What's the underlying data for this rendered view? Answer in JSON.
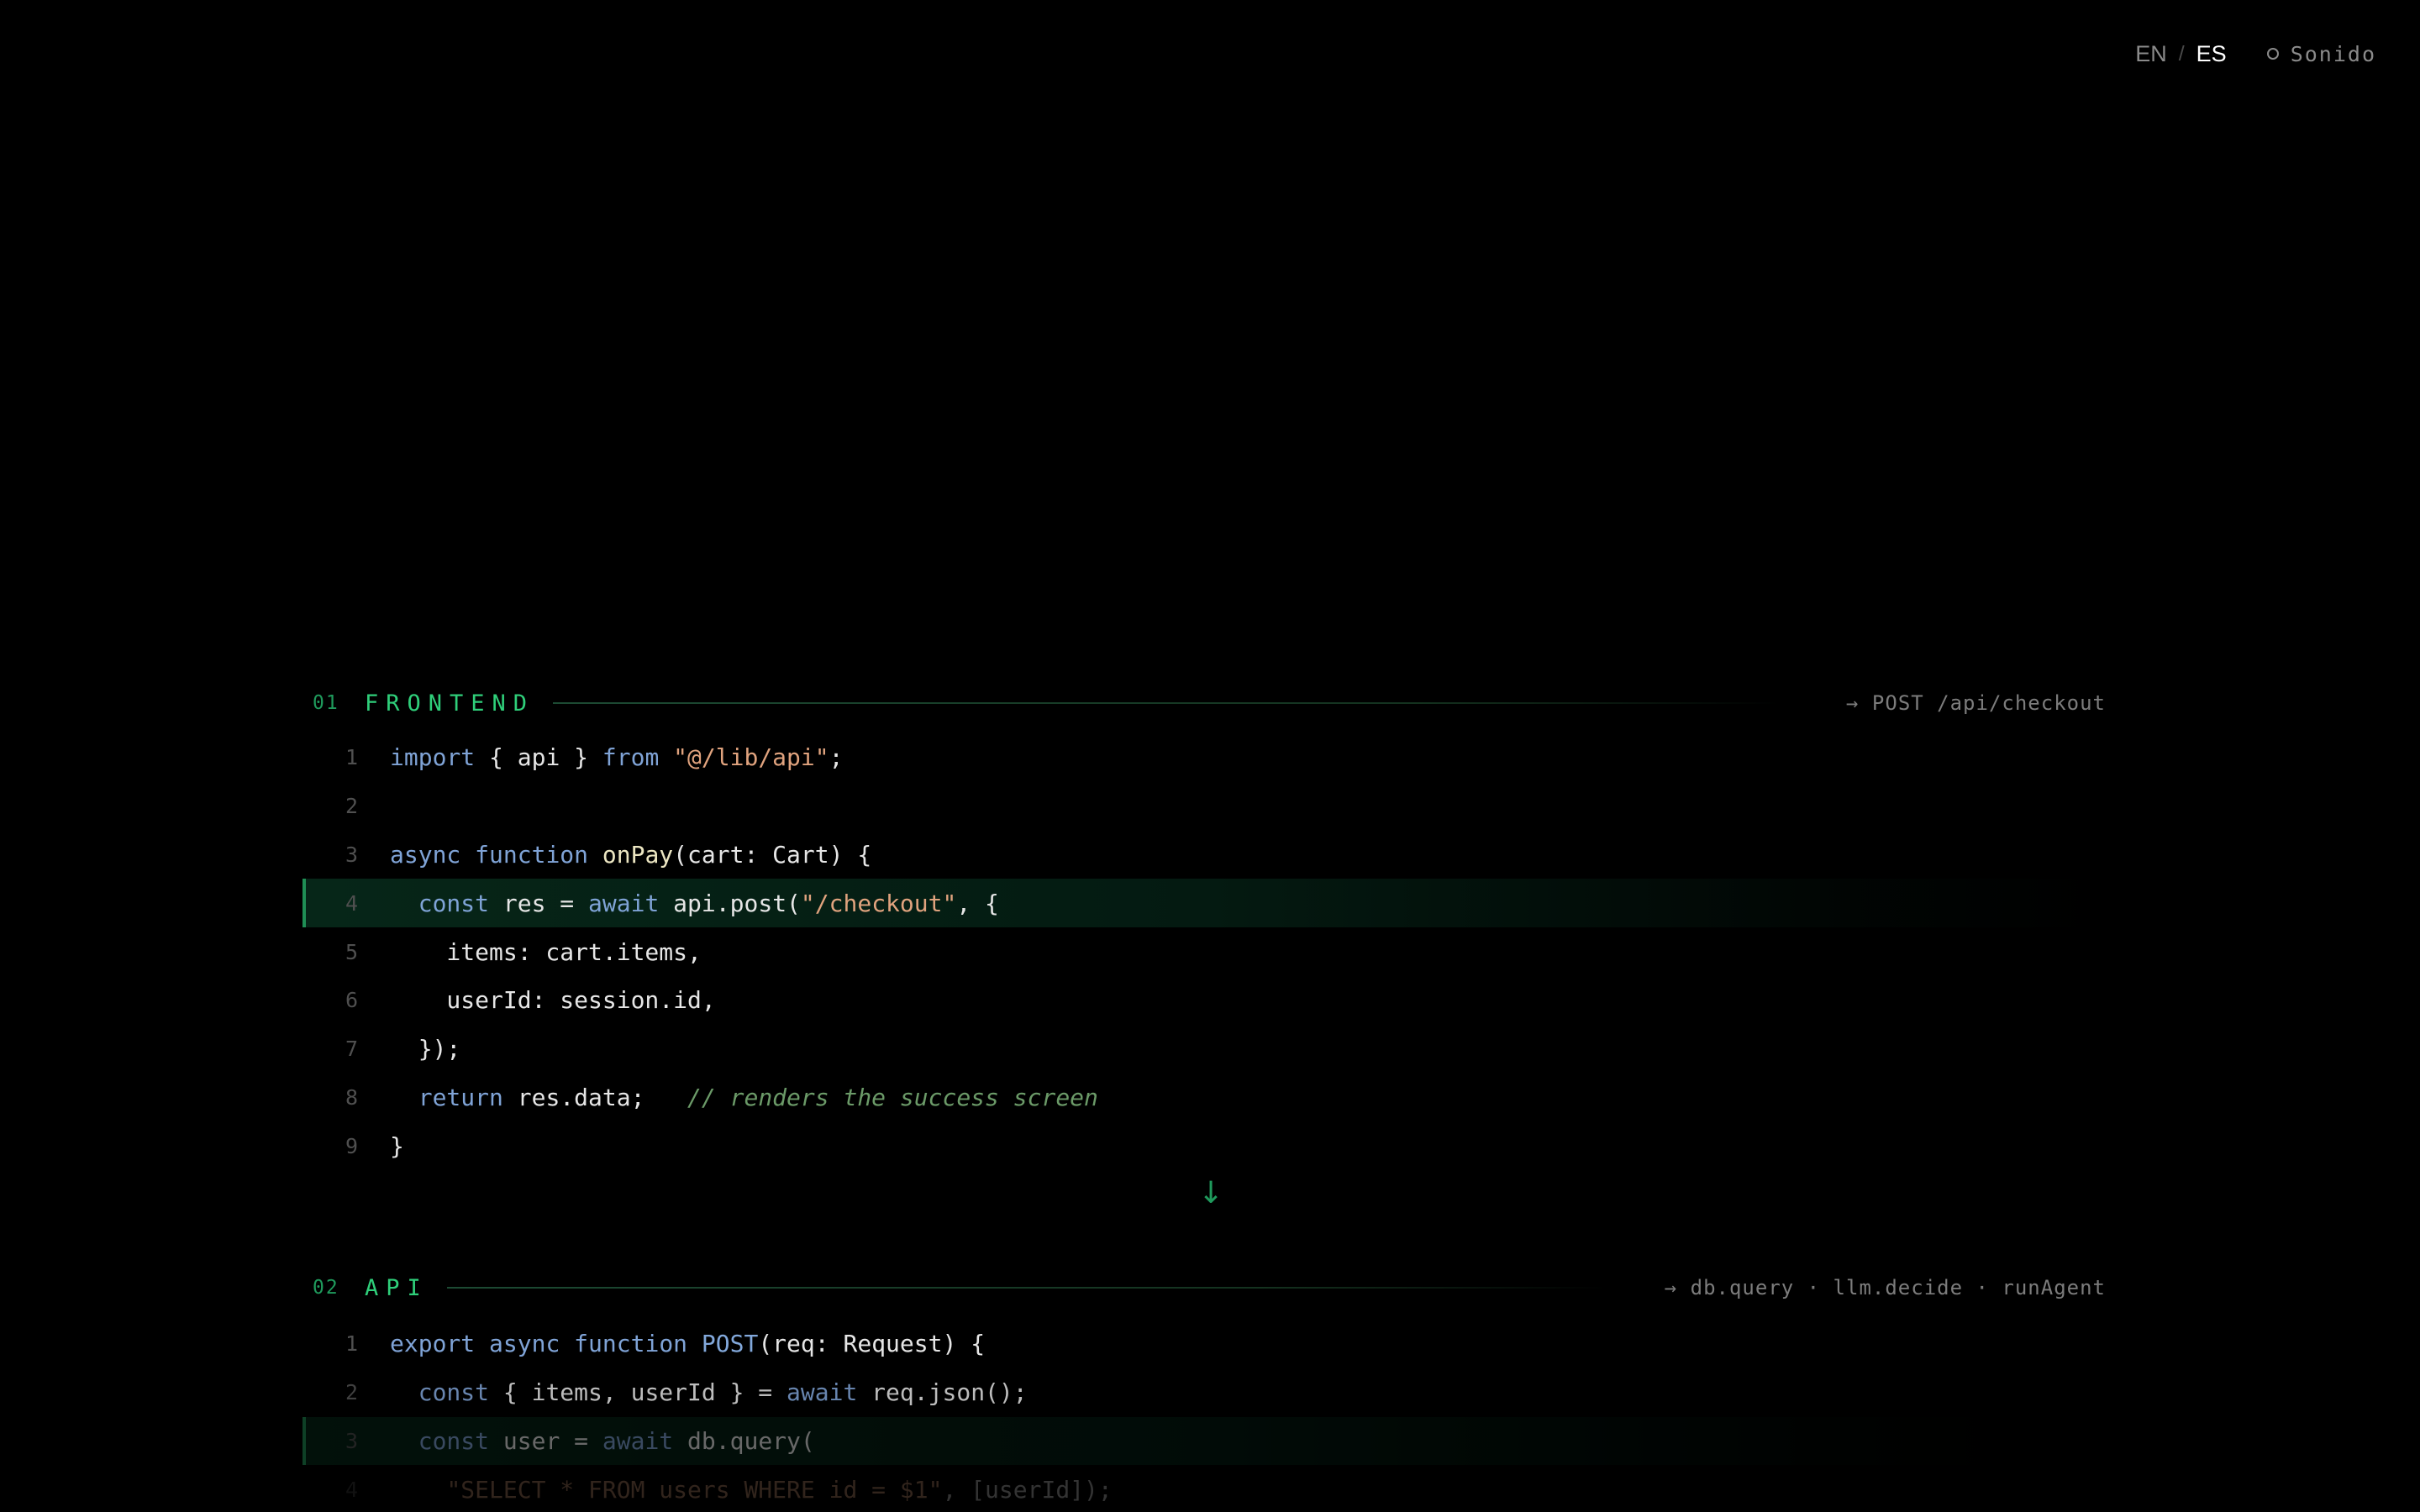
{
  "topbar": {
    "lang_en": "EN",
    "lang_sep": "/",
    "lang_es": "ES",
    "sound_label": "Sonido",
    "sound_icon": "circle-outline-icon"
  },
  "colors": {
    "background": "#000000",
    "accent_green": "#2fcf7a",
    "keyword_blue": "#7fa3d6",
    "string_orange": "#e0a37e",
    "comment_green": "#6b9a68"
  },
  "sections": [
    {
      "number": "01",
      "title": "FRONTEND",
      "meta": "→ POST /api/checkout",
      "lines": [
        {
          "n": "1"
        },
        {
          "n": "2"
        },
        {
          "n": "3"
        },
        {
          "n": "4"
        },
        {
          "n": "5"
        },
        {
          "n": "6"
        },
        {
          "n": "7"
        },
        {
          "n": "8"
        },
        {
          "n": "9"
        }
      ]
    },
    {
      "number": "02",
      "title": "API",
      "meta": "→ db.query · llm.decide · runAgent",
      "lines": [
        {
          "n": "1"
        },
        {
          "n": "2"
        },
        {
          "n": "3"
        },
        {
          "n": "4"
        }
      ]
    }
  ],
  "code": {
    "frontend": {
      "l1_import": "import",
      "l1_mid": " { api } ",
      "l1_from": "from",
      "l1_str": " \"@/lib/api\"",
      "l1_end": ";",
      "l3_async": "async",
      "l3_function": " function",
      "l3_name": " onPay",
      "l3_rest": "(cart: Cart) {",
      "l4_indent": "  ",
      "l4_const": "const",
      "l4_mid": " res = ",
      "l4_await": "await",
      "l4_call": " api.post(",
      "l4_str": "\"/checkout\"",
      "l4_end": ", {",
      "l5": "    items: cart.items,",
      "l6": "    userId: session.id,",
      "l7": "  });",
      "l8_indent": "  ",
      "l8_return": "return",
      "l8_mid": " res.data;   ",
      "l8_comment": "// renders the success screen",
      "l9": "}"
    },
    "api": {
      "l1_export": "export",
      "l1_async": " async",
      "l1_function": " function",
      "l1_name": " POST",
      "l1_rest": "(req: Request) {",
      "l2_indent": "  ",
      "l2_const": "const",
      "l2_mid": " { items, userId } = ",
      "l2_await": "await",
      "l2_end": " req.json();",
      "l3_indent": "  ",
      "l3_const": "const",
      "l3_mid": " user = ",
      "l3_await": "await",
      "l3_end": " db.query(",
      "l4_indent": "    ",
      "l4_str": "\"SELECT * FROM users WHERE id = $1\"",
      "l4_end": ", [userId]);"
    }
  },
  "flow_arrow": "↓"
}
